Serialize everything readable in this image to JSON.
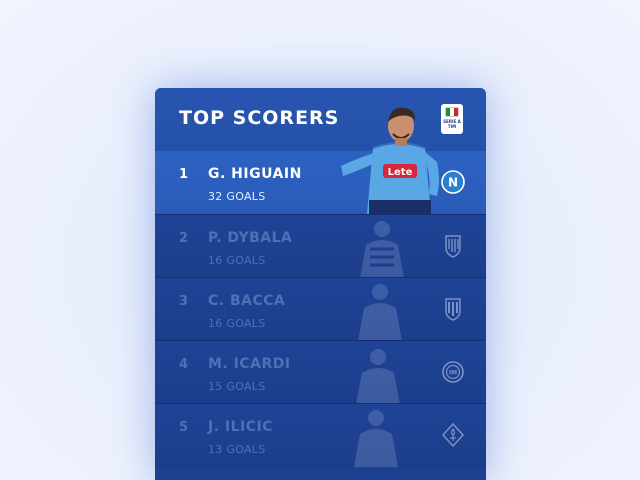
{
  "header": {
    "title": "TOP SCORERS",
    "league_logo_text_1": "SERIE A",
    "league_logo_text_2": "TIM",
    "league_logo_icon": "serie-a-logo"
  },
  "featured_player": {
    "shirt_sponsor": "Lete",
    "shirt_color": "#5aa7e6"
  },
  "scorers": [
    {
      "rank": "1",
      "name": "G. HIGUAIN",
      "goals": "32 GOALS",
      "club_icon": "napoli-crest-icon",
      "active": true
    },
    {
      "rank": "2",
      "name": "P. DYBALA",
      "goals": "16 GOALS",
      "club_icon": "juventus-crest-icon",
      "active": false
    },
    {
      "rank": "3",
      "name": "C. BACCA",
      "goals": "16 GOALS",
      "club_icon": "milan-crest-icon",
      "active": false
    },
    {
      "rank": "4",
      "name": "M. ICARDI",
      "goals": "15 GOALS",
      "club_icon": "inter-crest-icon",
      "active": false
    },
    {
      "rank": "5",
      "name": "J. ILICIC",
      "goals": "13 GOALS",
      "club_icon": "fiorentina-crest-icon",
      "active": false
    }
  ],
  "colors": {
    "card_bg": "#1d3f8f",
    "header_bg": "#2855b0",
    "active_row": "#2d62c2",
    "dim_text": "#4f6fb8"
  }
}
